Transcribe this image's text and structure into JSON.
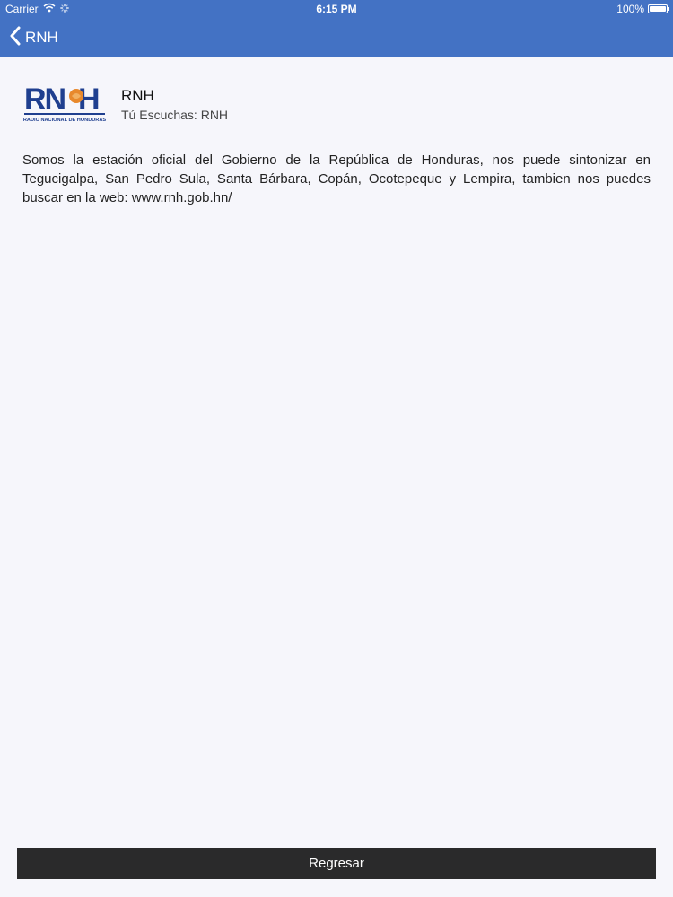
{
  "status_bar": {
    "carrier": "Carrier",
    "time": "6:15 PM",
    "battery": "100%",
    "battery_level": 1.0
  },
  "nav": {
    "back_label": "RNH",
    "back_icon": "chevron-left-icon"
  },
  "station": {
    "logo_text": "RNH",
    "logo_caption": "RADIO NACIONAL DE HONDURAS",
    "name": "RNH",
    "now_listening": "Tú Escuchas: RNH"
  },
  "description": "Somos la estación oficial del Gobierno de la República de Honduras, nos puede sintonizar en Tegucigalpa, San Pedro Sula, Santa Bárbara, Copán, Ocotepeque y Lempira, tambien nos puedes buscar en la web: www.rnh.gob.hn/",
  "footer": {
    "return_label": "Regresar"
  },
  "colors": {
    "nav_background": "#4372c4",
    "page_background": "#f6f6fb",
    "button_background": "#2a2a2b",
    "logo_blue": "#1f3f8f",
    "logo_orange": "#e8892c"
  }
}
